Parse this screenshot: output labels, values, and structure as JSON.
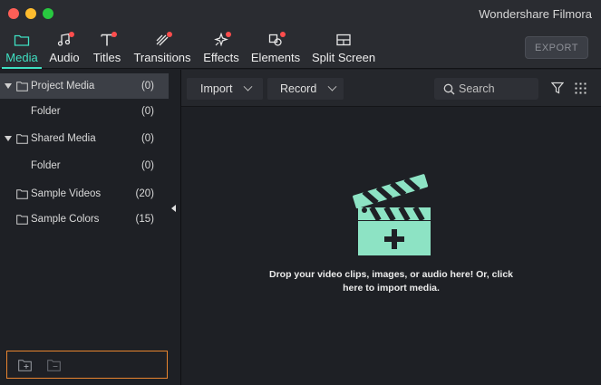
{
  "window": {
    "title": "Wondershare Filmora"
  },
  "tabs": [
    {
      "id": "media",
      "label": "Media",
      "icon": "folder-icon",
      "active": true,
      "dot": false
    },
    {
      "id": "audio",
      "label": "Audio",
      "icon": "music-note-icon",
      "active": false,
      "dot": true
    },
    {
      "id": "titles",
      "label": "Titles",
      "icon": "text-t-icon",
      "active": false,
      "dot": true
    },
    {
      "id": "transitions",
      "label": "Transitions",
      "icon": "transition-icon",
      "active": false,
      "dot": true
    },
    {
      "id": "effects",
      "label": "Effects",
      "icon": "sparkle-icon",
      "active": false,
      "dot": true
    },
    {
      "id": "elements",
      "label": "Elements",
      "icon": "elements-icon",
      "active": false,
      "dot": true
    },
    {
      "id": "splitscreen",
      "label": "Split Screen",
      "icon": "split-screen-icon",
      "active": false,
      "dot": false
    }
  ],
  "export_label": "EXPORT",
  "tree": [
    {
      "label": "Project Media",
      "count": "(0)",
      "expandable": true,
      "selected": true
    },
    {
      "label": "Folder",
      "count": "(0)",
      "expandable": false,
      "selected": false
    },
    {
      "label": "Shared Media",
      "count": "(0)",
      "expandable": true,
      "selected": false
    },
    {
      "label": "Folder",
      "count": "(0)",
      "expandable": false,
      "selected": false
    },
    {
      "label": "Sample Videos",
      "count": "(20)",
      "expandable": false,
      "selected": false
    },
    {
      "label": "Sample Colors",
      "count": "(15)",
      "expandable": false,
      "selected": false
    }
  ],
  "media_bar": {
    "import_label": "Import",
    "record_label": "Record",
    "search_placeholder": "Search"
  },
  "drop_zone": {
    "line1": "Drop your video clips, images, or audio here! Or, click",
    "line2": "here to import media."
  },
  "colors": {
    "accent": "#3fe0c2",
    "notification_dot": "#ff4d4d",
    "footer_border": "#e8842f",
    "clapper": "#8de3c4"
  }
}
